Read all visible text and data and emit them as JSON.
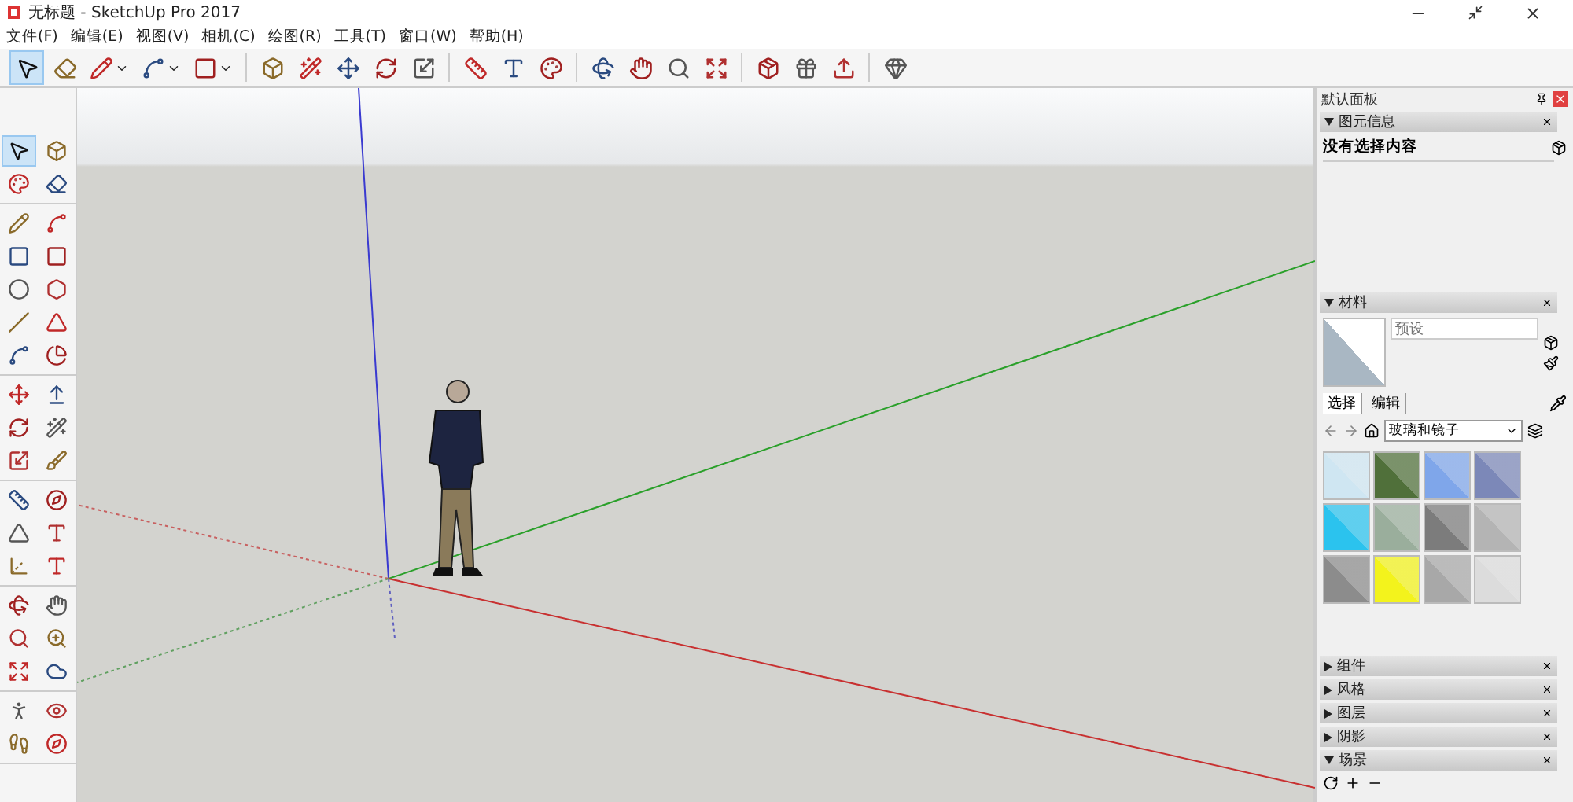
{
  "window": {
    "title": "无标题 - SketchUp Pro 2017"
  },
  "menu": [
    "文件(F)",
    "编辑(E)",
    "视图(V)",
    "相机(C)",
    "绘图(R)",
    "工具(T)",
    "窗口(W)",
    "帮助(H)"
  ],
  "toolbar": [
    [
      {
        "selected": true
      },
      {
        "selected": false
      },
      {
        "selected": false,
        "dropdown": true
      },
      {
        "selected": false,
        "dropdown": true
      },
      {
        "selected": false,
        "dropdown": true
      }
    ],
    [
      {
        "selected": false
      },
      {
        "selected": false
      },
      {
        "selected": false
      },
      {
        "selected": false
      },
      {
        "selected": false
      }
    ],
    [
      {
        "selected": false
      },
      {
        "selected": false
      },
      {
        "selected": false
      }
    ],
    [
      {
        "selected": false
      },
      {
        "selected": false
      },
      {
        "selected": false
      },
      {
        "selected": false
      }
    ],
    [
      {
        "selected": false
      },
      {
        "selected": false
      },
      {
        "selected": false
      }
    ],
    [
      {
        "selected": false
      }
    ]
  ],
  "left_toolbar": [
    [
      {
        "selected": true
      },
      {
        "selected": false
      },
      {
        "selected": false
      },
      {
        "selected": false
      }
    ],
    [
      {
        "selected": false
      },
      {
        "selected": false
      },
      {
        "selected": false
      },
      {
        "selected": false
      },
      {
        "selected": false
      },
      {
        "selected": false
      },
      {
        "selected": false
      },
      {
        "selected": false
      },
      {
        "selected": false
      },
      {
        "selected": false
      }
    ],
    [
      {
        "selected": false
      },
      {
        "selected": false
      },
      {
        "selected": false
      },
      {
        "selected": false
      },
      {
        "selected": false
      },
      {
        "selected": false
      }
    ],
    [
      {
        "selected": false
      },
      {
        "selected": false
      },
      {
        "selected": false
      },
      {
        "selected": false
      },
      {
        "selected": false
      },
      {
        "selected": false
      }
    ],
    [
      {
        "selected": false
      },
      {
        "selected": false
      },
      {
        "selected": false
      },
      {
        "selected": false
      },
      {
        "selected": false
      },
      {
        "selected": false
      }
    ],
    [
      {
        "selected": false
      },
      {
        "selected": false
      },
      {
        "selected": false
      },
      {
        "selected": false
      }
    ]
  ],
  "tray": {
    "title": "默认面板",
    "entity_info": {
      "title": "图元信息",
      "expanded": true,
      "text": "没有选择内容"
    },
    "materials": {
      "title": "材料",
      "expanded": true,
      "name_placeholder": "预设",
      "tabs": [
        {
          "label": "选择",
          "selected": true
        },
        {
          "label": "编辑",
          "selected": false
        }
      ],
      "library": "玻璃和镜子",
      "swatches": [
        {
          "color": "#cfe6f2"
        },
        {
          "color": "#50703a"
        },
        {
          "color": "#7fa6ea"
        },
        {
          "color": "#7c88b8"
        },
        {
          "color": "#2bc3ee"
        },
        {
          "color": "#9aae9c"
        },
        {
          "color": "#7c7c7c"
        },
        {
          "color": "#b4b4b4"
        },
        {
          "color": "#8c8c8c"
        },
        {
          "color": "#f3f31c"
        },
        {
          "color": "#a8a8a8"
        },
        {
          "color": "#dcdcdc"
        }
      ]
    },
    "sections": [
      {
        "title": "组件",
        "expanded": false
      },
      {
        "title": "风格",
        "expanded": false
      },
      {
        "title": "图层",
        "expanded": false
      },
      {
        "title": "阴影",
        "expanded": false
      },
      {
        "title": "场景",
        "expanded": true
      }
    ]
  }
}
